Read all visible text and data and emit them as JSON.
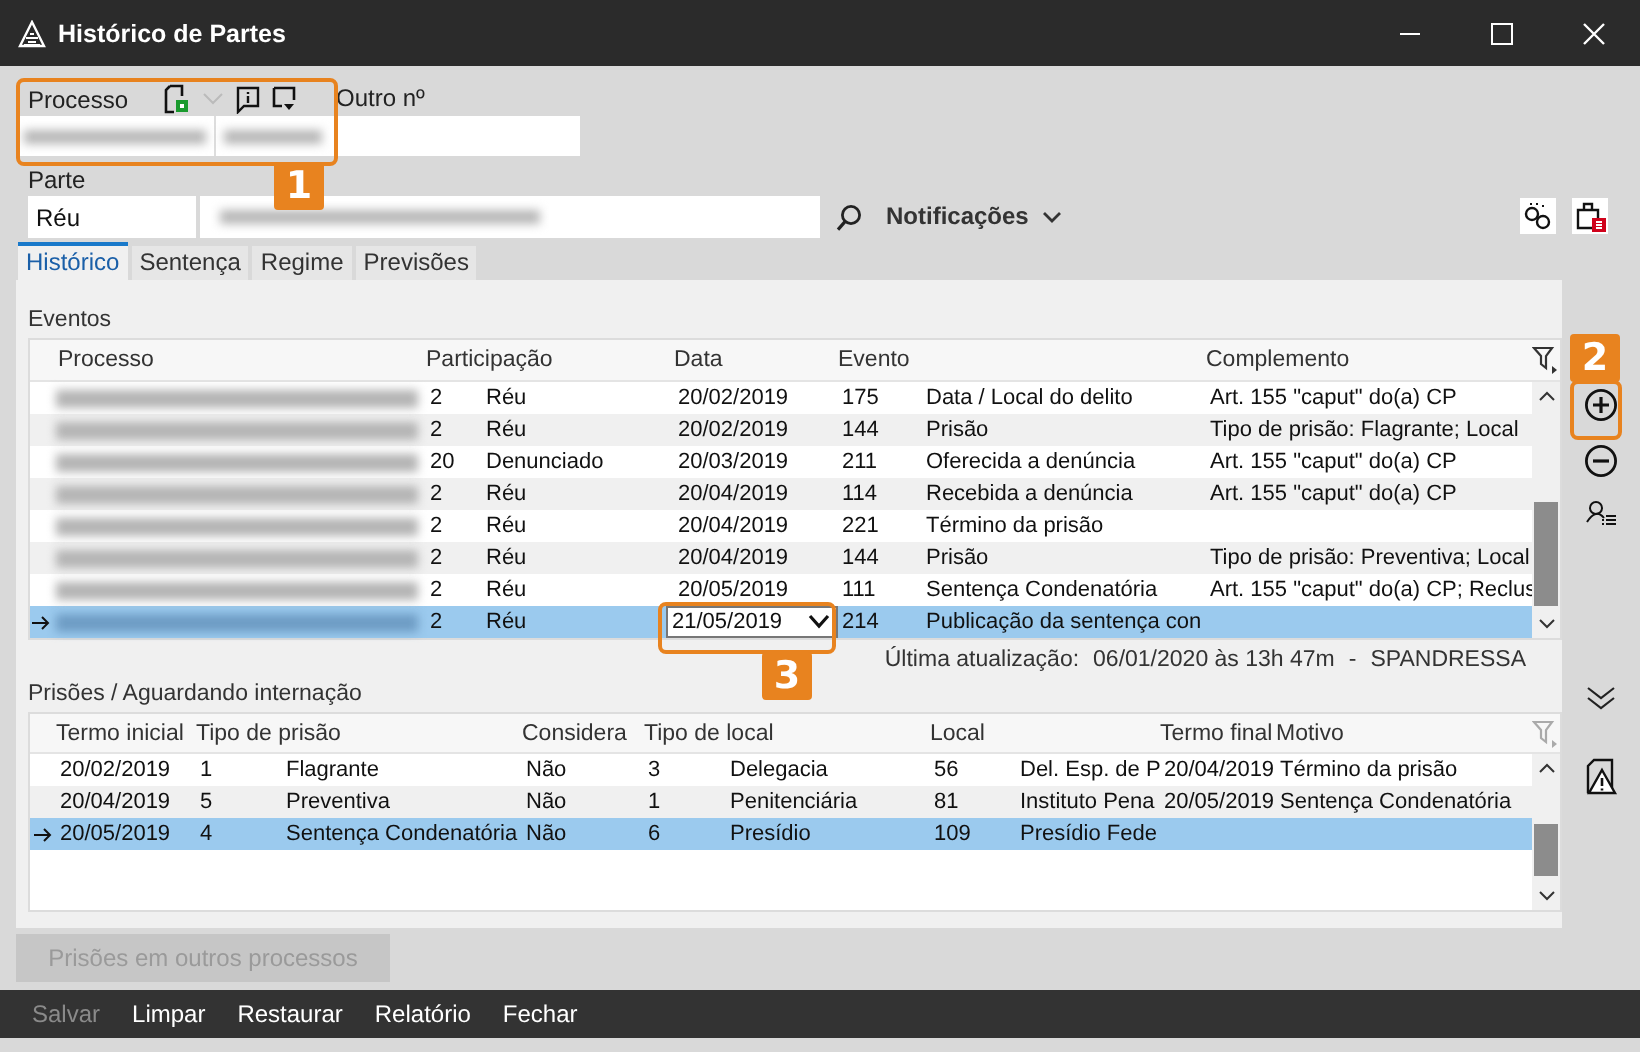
{
  "window": {
    "title": "Histórico de Partes"
  },
  "header": {
    "processo_label": "Processo",
    "outro_label": "Outro nº",
    "parte_label": "Parte",
    "parte_tipo": "Réu",
    "notificacoes": "Notificações"
  },
  "tabs": [
    {
      "label": "Histórico",
      "selected": true
    },
    {
      "label": "Sentença",
      "selected": false
    },
    {
      "label": "Regime",
      "selected": false
    },
    {
      "label": "Previsões",
      "selected": false
    }
  ],
  "eventos": {
    "title": "Eventos",
    "columns": [
      "Processo",
      "Participação",
      "Data",
      "Evento",
      "Complemento"
    ],
    "rows": [
      {
        "part_code": "2",
        "part": "Réu",
        "data": "20/02/2019",
        "evento_code": "175",
        "evento": "Data / Local do delito",
        "complemento": "Art. 155 \"caput\" do(a) CP",
        "selected": false,
        "editing": false
      },
      {
        "part_code": "2",
        "part": "Réu",
        "data": "20/02/2019",
        "evento_code": "144",
        "evento": "Prisão",
        "complemento": "Tipo de prisão: Flagrante; Local",
        "selected": false,
        "editing": false
      },
      {
        "part_code": "20",
        "part": "Denunciado",
        "data": "20/03/2019",
        "evento_code": "211",
        "evento": "Oferecida a denúncia",
        "complemento": "Art. 155 \"caput\" do(a) CP",
        "selected": false,
        "editing": false
      },
      {
        "part_code": "2",
        "part": "Réu",
        "data": "20/04/2019",
        "evento_code": "114",
        "evento": "Recebida a denúncia",
        "complemento": "Art. 155 \"caput\" do(a) CP",
        "selected": false,
        "editing": false
      },
      {
        "part_code": "2",
        "part": "Réu",
        "data": "20/04/2019",
        "evento_code": "221",
        "evento": "Término da prisão",
        "selected": false,
        "editing": false
      },
      {
        "part_code": "2",
        "part": "Réu",
        "data": "20/04/2019",
        "evento_code": "144",
        "evento": "Prisão",
        "complemento": "Tipo de prisão: Preventiva; Local",
        "selected": false,
        "editing": false
      },
      {
        "part_code": "2",
        "part": "Réu",
        "data": "20/05/2019",
        "evento_code": "111",
        "evento": "Sentença Condenatória",
        "complemento": "Art. 155 \"caput\" do(a) CP; Reclus",
        "selected": false,
        "editing": false
      },
      {
        "part_code": "2",
        "part": "Réu",
        "data": "21/05/2019",
        "evento_code": "214",
        "evento": "Publicação da sentença con",
        "selected": true,
        "editing": true
      }
    ]
  },
  "last_update": {
    "label": "Última atualização:",
    "value": "06/01/2020 às 13h 47m",
    "separator": "-",
    "user": "SPANDRESSA"
  },
  "prisoes": {
    "title": "Prisões / Aguardando internação",
    "columns": [
      "Termo inicial",
      "Tipo de prisão",
      "Considera",
      "Tipo de local",
      "Local",
      "Termo final",
      "Motivo"
    ],
    "rows": [
      {
        "termo_inicial": "20/02/2019",
        "tipo_code": "1",
        "tipo": "Flagrante",
        "considera": "Não",
        "tipo_local_code": "3",
        "tipo_local": "Delegacia",
        "local_code": "56",
        "local": "Del. Esp. de P",
        "termo_final": "20/04/2019",
        "motivo": "Término da prisão",
        "selected": false
      },
      {
        "termo_inicial": "20/04/2019",
        "tipo_code": "5",
        "tipo": "Preventiva",
        "considera": "Não",
        "tipo_local_code": "1",
        "tipo_local": "Penitenciária",
        "local_code": "81",
        "local": "Instituto Pena",
        "termo_final": "20/05/2019",
        "motivo": "Sentença Condenatória",
        "selected": false
      },
      {
        "termo_inicial": "20/05/2019",
        "tipo_code": "4",
        "tipo": "Sentença Condenatória",
        "considera": "Não",
        "tipo_local_code": "6",
        "tipo_local": "Presídio",
        "local_code": "109",
        "local": "Presídio Fede",
        "selected": true
      }
    ]
  },
  "outros_button": {
    "label": "Prisões em outros processos",
    "disabled": true
  },
  "footer": [
    {
      "label": "Salvar",
      "disabled": true
    },
    {
      "label": "Limpar",
      "disabled": false
    },
    {
      "label": "Restaurar",
      "disabled": false
    },
    {
      "label": "Relatório",
      "disabled": false
    },
    {
      "label": "Fechar",
      "disabled": false
    }
  ],
  "callouts": [
    {
      "number": "1"
    },
    {
      "number": "2"
    },
    {
      "number": "3"
    }
  ]
}
